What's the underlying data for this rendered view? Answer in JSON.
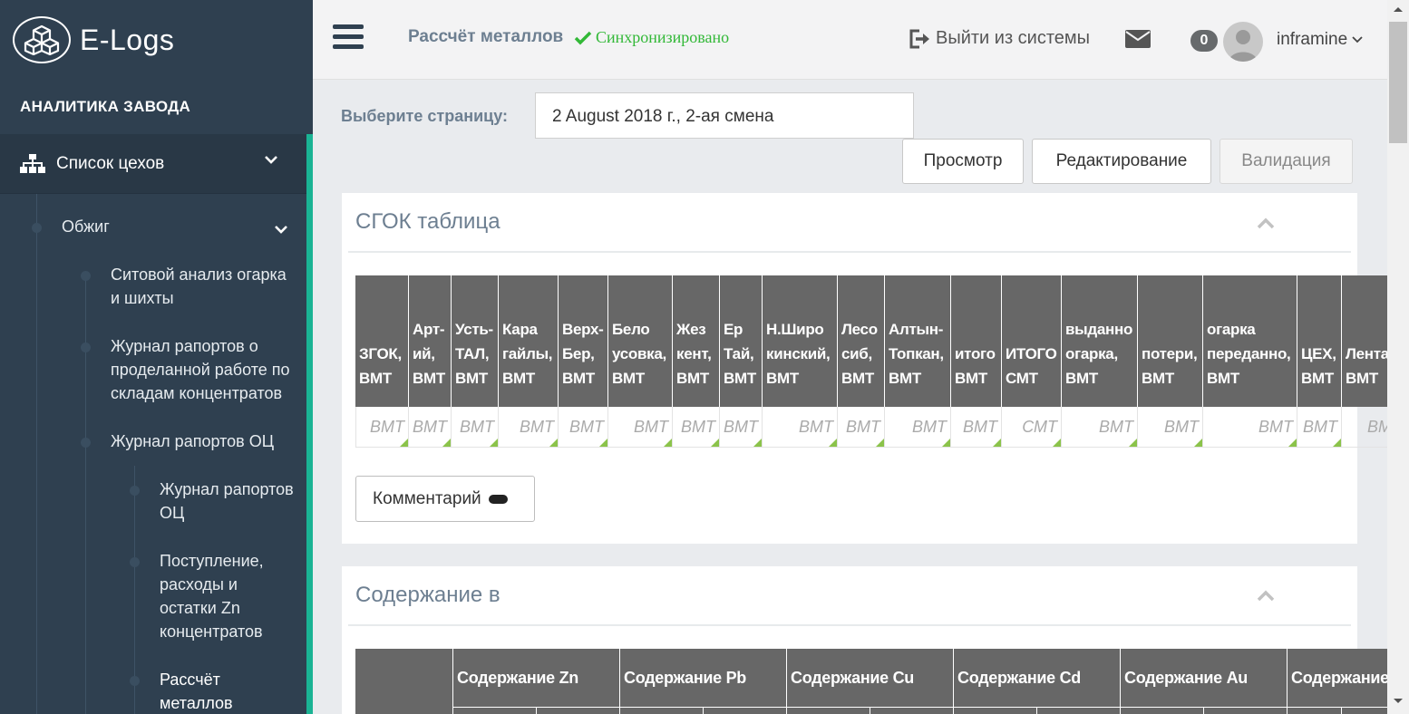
{
  "app": {
    "name": "E-Logs"
  },
  "sidebar": {
    "section_title": "АНАЛИТИКА ЗАВОДА",
    "main_menu": {
      "label": "Список цехов"
    },
    "tree": {
      "obzhig": "Обжиг",
      "sito": "Ситовой анализ огарка\nи шихты",
      "zhurnal_sklad": "Журнал рапортов о\nпроделанной работе по\nскладам концентратов",
      "zhurnal_oc": "Журнал рапортов ОЦ",
      "sub_zhurnal_oc": "Журнал рапортов\nОЦ",
      "postuplenie": "Поступление,\nрасходы и\nостатки Zn\nконцентратов",
      "raschet": "Рассчёт\nметаллов"
    }
  },
  "topbar": {
    "page_name": "Рассчёт металлов",
    "sync_status": "Синхронизировано",
    "logout": "Выйти из системы",
    "badge_count": "0",
    "username": "inframine"
  },
  "controls": {
    "select_label": "Выберите страницу:",
    "select_value": "2 August 2018 г., 2-ая смена",
    "btn_view": "Просмотр",
    "btn_edit": "Редактирование",
    "btn_validate": "Валидация"
  },
  "panel_sgok": {
    "title": "СГОК таблица",
    "columns": [
      "ЗГОК,\nВМТ",
      "Арт-\nий,\nВМТ",
      "Усть-\nТАЛ,\nВМТ",
      "Кара\nгайлы,\nВМТ",
      "Верх-\nБер,\nВМТ",
      "Бело\nусовка,\nВМТ",
      "Жез\nкент,\nВМТ",
      "Ер\nТай,\nВМТ",
      "Н.Широ\nкинский,\nВМТ",
      "Лесо\nсиб,\nВМТ",
      "Алтын-\nТопкан,\nВМТ",
      "итого\nВМТ",
      "ИТОГО\nСМТ",
      "выданно\nогарка,\nВМТ",
      "потери,\nВМТ",
      "огарка\nпереданно,\nВМТ",
      "ЦЕХ,\nВМТ",
      "Лента\nВМТ"
    ],
    "placeholders": [
      "ВМТ",
      "ВМТ",
      "ВМТ",
      "ВМТ",
      "ВМТ",
      "ВМТ",
      "ВМТ",
      "ВМТ",
      "ВМТ",
      "ВМТ",
      "ВМТ",
      "ВМТ",
      "СМТ",
      "ВМТ",
      "ВМТ",
      "ВМТ",
      "ВМТ",
      "ВМ"
    ],
    "comment_btn": "Комментарий"
  },
  "panel_soder": {
    "title": "Содержание в",
    "headers": [
      "",
      "Содержание Zn",
      "Содержание Pb",
      "Содержание Cu",
      "Содержание Cd",
      "Содержание Au",
      "Содержание"
    ]
  },
  "colors": {
    "sidebar": "#2f4050",
    "accent": "#1ab394",
    "sync": "#32b837",
    "table_header": "#676767"
  },
  "icons": [
    "cubes-icon",
    "sitemap-icon",
    "chevron-down-icon",
    "hamburger-icon",
    "check-icon",
    "logout-icon",
    "envelope-icon",
    "avatar",
    "chevron-up-icon"
  ]
}
